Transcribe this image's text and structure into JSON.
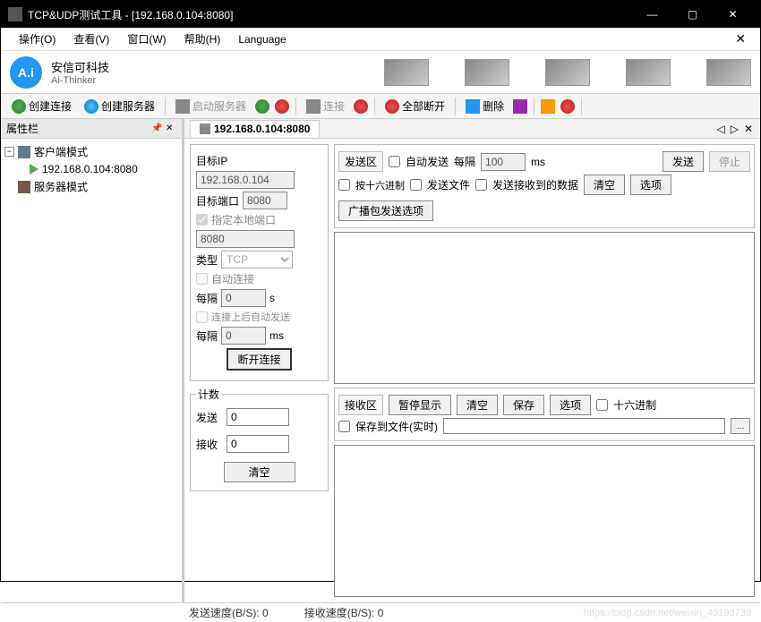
{
  "window": {
    "title": "TCP&UDP测试工具 - [192.168.0.104:8080]"
  },
  "menus": {
    "operate": "操作(O)",
    "view": "查看(V)",
    "window": "窗口(W)",
    "help": "帮助(H)",
    "language": "Language"
  },
  "brand": {
    "cn": "安信可科技",
    "en": "Ai-Thinker"
  },
  "toolbar": {
    "create_conn": "创建连接",
    "create_server": "创建服务器",
    "start_server": "启动服务器",
    "connect": "连接",
    "disconnect_all": "全部断开",
    "delete": "删除"
  },
  "sidebar": {
    "title": "属性栏",
    "client_mode": "客户端模式",
    "connection": "192.168.0.104:8080",
    "server_mode": "服务器模式"
  },
  "tab": {
    "label": "192.168.0.104:8080"
  },
  "target": {
    "ip_label": "目标IP",
    "ip_value": "192.168.0.104",
    "port_label": "目标端口",
    "port_value": "8080",
    "local_port_label": "指定本地端口",
    "local_port_value": "8080",
    "type_label": "类型",
    "type_value": "TCP",
    "auto_connect": "自动连接",
    "interval_label": "每隔",
    "interval_value": "0",
    "interval_unit_s": "s",
    "auto_send_after_conn": "连接上后自动发送",
    "interval2_value": "0",
    "interval_unit_ms": "ms",
    "disconnect_btn": "断开连接"
  },
  "counter": {
    "legend": "计数",
    "send_label": "发送",
    "send_value": "0",
    "recv_label": "接收",
    "recv_value": "0",
    "clear": "清空"
  },
  "send": {
    "section": "发送区",
    "auto_send": "自动发送",
    "interval_label": "每隔",
    "interval_value": "100",
    "interval_unit": "ms",
    "send_btn": "发送",
    "stop_btn": "停止",
    "hex": "按十六进制",
    "send_file": "发送文件",
    "send_recv_data": "发送接收到的数据",
    "clear": "清空",
    "options": "选项",
    "broadcast": "广播包发送选项"
  },
  "recv": {
    "section": "接收区",
    "pause": "暂停显示",
    "clear": "清空",
    "save": "保存",
    "options": "选项",
    "hex": "十六进制",
    "save_to_file": "保存到文件(实时)",
    "path": ""
  },
  "status": {
    "send_speed_label": "发送速度(B/S): ",
    "send_speed_value": "0",
    "recv_speed_label": "接收速度(B/S): ",
    "recv_speed_value": "0",
    "watermark": "https://blog.csdn.net/weixin_43193739"
  }
}
